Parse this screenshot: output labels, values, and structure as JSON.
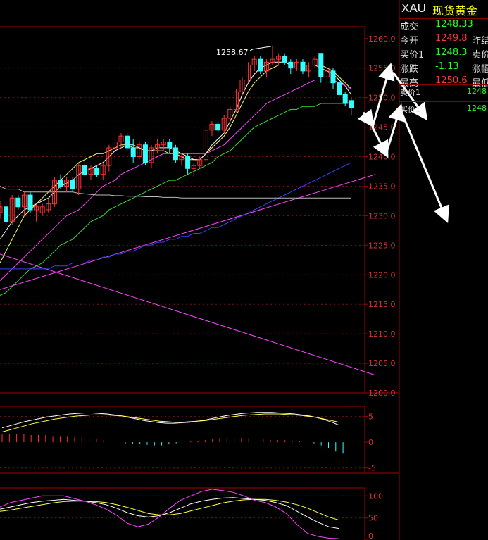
{
  "quote": {
    "symbol": "XAU",
    "name": "现货黄金",
    "rows": [
      {
        "label": "成交",
        "value": "1248.33",
        "color": "#22ff22",
        "label2": ""
      },
      {
        "label": "今开",
        "value": "1249.8",
        "color": "#ff3333",
        "label2": "昨结"
      },
      {
        "label": "买价1",
        "value": "1248.3",
        "color": "#22ff22",
        "label2": "卖价"
      },
      {
        "label": "涨跌",
        "value": "-1.13",
        "color": "#22ff22",
        "label2": "涨幅"
      },
      {
        "label": "最高",
        "value": "1250.6",
        "color": "#ff3333",
        "label2": "最低"
      }
    ],
    "orderbook": [
      {
        "label": "卖价1",
        "value": "1248"
      },
      {
        "label": "买价1",
        "value": "1248"
      }
    ]
  },
  "chart_data": [
    {
      "type": "candlestick",
      "ylim": [
        1200,
        1262
      ],
      "yticks": [
        "1260.0",
        "1255.0",
        "1250.0",
        "1245.0",
        "1240.0",
        "1235.0",
        "1230.0",
        "1225.0",
        "1220.0",
        "1215.0",
        "1210.0",
        "1205.0",
        "1200.0"
      ],
      "ytick_values": [
        1260,
        1255,
        1250,
        1245,
        1240,
        1235,
        1230,
        1225,
        1220,
        1215,
        1210,
        1205,
        1200
      ],
      "annotation": {
        "text": "1258.67",
        "value": 1258.67
      },
      "candles": [
        [
          1230.5,
          1232.5,
          1229.5,
          1231.5
        ],
        [
          1231.5,
          1232.0,
          1228.5,
          1229.0
        ],
        [
          1229.0,
          1233.5,
          1228.5,
          1233.0
        ],
        [
          1233.0,
          1233.5,
          1231.0,
          1231.5
        ],
        [
          1231.5,
          1234.0,
          1230.0,
          1233.5
        ],
        [
          1233.5,
          1234.0,
          1230.5,
          1231.0
        ],
        [
          1231.0,
          1232.0,
          1229.0,
          1231.5
        ],
        [
          1230.5,
          1232.0,
          1230.0,
          1231.5
        ],
        [
          1231.0,
          1233.0,
          1230.5,
          1232.0
        ],
        [
          1232.0,
          1236.5,
          1231.5,
          1236.0
        ],
        [
          1236.0,
          1237.0,
          1234.5,
          1235.0
        ],
        [
          1235.0,
          1236.5,
          1234.0,
          1236.0
        ],
        [
          1236.0,
          1236.5,
          1234.0,
          1234.5
        ],
        [
          1234.5,
          1239.0,
          1233.5,
          1238.5
        ],
        [
          1238.5,
          1240.0,
          1236.5,
          1237.0
        ],
        [
          1237.0,
          1238.5,
          1236.0,
          1238.0
        ],
        [
          1238.0,
          1238.5,
          1236.5,
          1237.0
        ],
        [
          1237.0,
          1239.0,
          1236.0,
          1238.5
        ],
        [
          1238.5,
          1242.0,
          1237.5,
          1241.5
        ],
        [
          1241.5,
          1243.0,
          1240.0,
          1242.5
        ],
        [
          1242.5,
          1244.0,
          1241.5,
          1243.5
        ],
        [
          1243.5,
          1244.0,
          1241.0,
          1241.5
        ],
        [
          1241.5,
          1243.0,
          1239.0,
          1240.0
        ],
        [
          1240.0,
          1242.5,
          1239.5,
          1242.0
        ],
        [
          1242.0,
          1242.5,
          1238.5,
          1239.0
        ],
        [
          1239.0,
          1242.0,
          1238.0,
          1241.5
        ],
        [
          1241.5,
          1243.0,
          1240.5,
          1242.0
        ],
        [
          1242.0,
          1243.0,
          1241.0,
          1242.5
        ],
        [
          1242.5,
          1243.0,
          1240.5,
          1241.5
        ],
        [
          1241.5,
          1242.0,
          1239.0,
          1239.5
        ],
        [
          1239.5,
          1240.5,
          1238.5,
          1240.0
        ],
        [
          1240.0,
          1240.5,
          1237.0,
          1238.0
        ],
        [
          1238.0,
          1239.0,
          1236.5,
          1238.5
        ],
        [
          1238.5,
          1240.0,
          1238.0,
          1239.5
        ],
        [
          1239.5,
          1245.0,
          1239.0,
          1244.5
        ],
        [
          1244.5,
          1246.0,
          1243.5,
          1245.5
        ],
        [
          1245.5,
          1246.0,
          1244.0,
          1244.5
        ],
        [
          1244.5,
          1247.0,
          1244.0,
          1246.5
        ],
        [
          1246.5,
          1248.5,
          1246.0,
          1248.0
        ],
        [
          1248.0,
          1251.5,
          1247.5,
          1251.0
        ],
        [
          1251.0,
          1253.5,
          1250.5,
          1253.0
        ],
        [
          1253.0,
          1256.0,
          1252.5,
          1255.5
        ],
        [
          1255.5,
          1257.0,
          1254.5,
          1256.5
        ],
        [
          1256.5,
          1257.0,
          1254.0,
          1254.5
        ],
        [
          1254.5,
          1256.5,
          1253.5,
          1256.0
        ],
        [
          1256.0,
          1258.67,
          1255.5,
          1256.5
        ],
        [
          1256.5,
          1257.5,
          1255.5,
          1257.0
        ],
        [
          1257.0,
          1257.5,
          1255.5,
          1256.0
        ],
        [
          1256.0,
          1256.5,
          1254.0,
          1255.0
        ],
        [
          1255.0,
          1256.5,
          1254.5,
          1256.0
        ],
        [
          1256.0,
          1256.5,
          1254.0,
          1254.5
        ],
        [
          1254.5,
          1256.0,
          1253.5,
          1255.5
        ],
        [
          1255.5,
          1257.0,
          1255.0,
          1256.5
        ],
        [
          1257.5,
          1257.5,
          1252.5,
          1253.5
        ],
        [
          1253.5,
          1255.0,
          1251.5,
          1254.5
        ],
        [
          1254.5,
          1255.0,
          1251.5,
          1252.5
        ],
        [
          1252.5,
          1253.5,
          1250.0,
          1250.5
        ],
        [
          1250.5,
          1251.0,
          1248.5,
          1249.0
        ],
        [
          1249.5,
          1250.0,
          1247.0,
          1248.3
        ]
      ],
      "ma_lines": [
        {
          "color": "#ffff66",
          "values": [
            1222,
            1224,
            1226,
            1228,
            1230,
            1231,
            1232,
            1233,
            1234,
            1235,
            1236,
            1237,
            1238,
            1239,
            1239.5,
            1240,
            1240.5,
            1240.5,
            1241,
            1241.5,
            1242,
            1242,
            1241.5,
            1241.5,
            1241,
            1241,
            1241,
            1241,
            1240.5,
            1240.5,
            1240,
            1239.5,
            1239.5,
            1239.5,
            1240.5,
            1241.5,
            1242.5,
            1243.5,
            1245,
            1247,
            1249,
            1251,
            1252.5,
            1253.5,
            1254.5,
            1255,
            1255.5,
            1255.5,
            1255.5,
            1255.5,
            1255.5,
            1255.5,
            1255.5,
            1255.5,
            1255,
            1254.5,
            1253.5,
            1252.5,
            1251.5
          ]
        },
        {
          "color": "#ffffff",
          "values": [
            1226,
            1227.5,
            1229,
            1230,
            1231,
            1231.5,
            1232,
            1232.5,
            1233,
            1234,
            1235,
            1235.5,
            1236,
            1237,
            1237.5,
            1238,
            1238.5,
            1239,
            1240,
            1241,
            1241.5,
            1242,
            1242,
            1241.5,
            1241,
            1241,
            1241.5,
            1241.5,
            1241.5,
            1241,
            1240.5,
            1240,
            1239.5,
            1239.5,
            1240.5,
            1242,
            1243,
            1244,
            1246,
            1248,
            1250.5,
            1252.5,
            1254,
            1255,
            1255.5,
            1256,
            1256,
            1256,
            1255.5,
            1255.5,
            1255.5,
            1255.5,
            1255.5,
            1255,
            1254.5,
            1254,
            1253,
            1252,
            1250.5
          ]
        },
        {
          "color": "#ff44ff",
          "values": [
            1219,
            1220,
            1221,
            1222,
            1223,
            1224,
            1225,
            1226,
            1227,
            1228,
            1229,
            1230,
            1230.5,
            1231,
            1232,
            1233,
            1234,
            1235,
            1235.5,
            1236,
            1237,
            1237.5,
            1238,
            1238.5,
            1239,
            1239.5,
            1240,
            1240.5,
            1240.5,
            1240.5,
            1240.5,
            1240.5,
            1240.5,
            1240.5,
            1240.5,
            1241,
            1241.5,
            1242,
            1243,
            1244,
            1245,
            1246,
            1247,
            1248,
            1249,
            1249.5,
            1250,
            1250.5,
            1251,
            1251.5,
            1252,
            1252.5,
            1253,
            1253,
            1253,
            1253,
            1252.5,
            1252,
            1251.5
          ]
        },
        {
          "color": "#33dd33",
          "values": [
            1216.5,
            1217,
            1218,
            1219,
            1220,
            1221,
            1221.5,
            1222,
            1223,
            1224,
            1225,
            1225.5,
            1226,
            1227,
            1228,
            1229,
            1229.5,
            1230,
            1231,
            1231.5,
            1232,
            1232.5,
            1233,
            1233.5,
            1234,
            1234.5,
            1235,
            1235.5,
            1236,
            1236,
            1236.5,
            1237,
            1237.5,
            1238,
            1238.5,
            1239,
            1240,
            1240.5,
            1241,
            1242,
            1243,
            1244,
            1245,
            1245.5,
            1246,
            1246.5,
            1247,
            1247.5,
            1248,
            1248,
            1248.5,
            1248.5,
            1248.5,
            1249,
            1249,
            1249,
            1249,
            1249,
            1249.2
          ]
        },
        {
          "color": "#3344ff",
          "values": [
            1221,
            1221,
            1221,
            1221,
            1221,
            1221,
            1221,
            1221,
            1221,
            1221.5,
            1221.5,
            1221.5,
            1222,
            1222,
            1222,
            1222.5,
            1222.5,
            1223,
            1223,
            1223.5,
            1223.5,
            1224,
            1224,
            1224.5,
            1225,
            1225,
            1225.5,
            1225.5,
            1226,
            1226,
            1226.5,
            1226.5,
            1227,
            1227,
            1227.5,
            1228,
            1228,
            1228.5,
            1229,
            1229.5,
            1230,
            1230.5,
            1231,
            1231.5,
            1232,
            1232.5,
            1233,
            1233.5,
            1234,
            1234.5,
            1235,
            1235.5,
            1236,
            1236.5,
            1237,
            1237.5,
            1238,
            1238.5,
            1239
          ]
        },
        {
          "color": "#bbbbbb",
          "values": [
            1235,
            1234.5,
            1234.5,
            1234.5,
            1234,
            1234,
            1234,
            1234,
            1234,
            1234,
            1234,
            1234,
            1234,
            1233.8,
            1233.7,
            1233.6,
            1233.5,
            1233.5,
            1233.5,
            1233.4,
            1233.4,
            1233.3,
            1233.3,
            1233.3,
            1233.2,
            1233.2,
            1233.2,
            1233.1,
            1233.1,
            1233.1,
            1233,
            1233,
            1233,
            1233,
            1233,
            1233,
            1233,
            1233,
            1233,
            1233,
            1233,
            1233,
            1233,
            1233,
            1233,
            1233,
            1233,
            1233,
            1233,
            1233,
            1233,
            1233,
            1233,
            1233,
            1233,
            1233,
            1233,
            1233,
            1233
          ]
        }
      ],
      "trend_lines": [
        {
          "color": "#ff44ff",
          "from": [
            0,
            1217.5
          ],
          "to": [
            62,
            1237
          ]
        },
        {
          "color": "#ff44ff",
          "from": [
            0,
            1223.5
          ],
          "to": [
            62,
            1203
          ]
        }
      ],
      "arrows": [
        {
          "from": [
            60,
            1247.5
          ],
          "to": [
            61.4,
            1245.5
          ]
        },
        {
          "from": [
            61.5,
            1245.0
          ],
          "to": [
            64.4,
            1255.2
          ]
        },
        {
          "from": [
            61.5,
            1245.0
          ],
          "to": [
            63.8,
            1240.4
          ]
        },
        {
          "from": [
            63.9,
            1241.0
          ],
          "to": [
            66.1,
            1248.3
          ]
        },
        {
          "from": [
            64.9,
            1254.3
          ],
          "to": [
            70.2,
            1246.7
          ]
        },
        {
          "from": [
            66.2,
            1247.8
          ],
          "to": [
            73.7,
            1229.4
          ]
        }
      ]
    },
    {
      "type": "macd",
      "ylim": [
        -6,
        7
      ],
      "yticks": [
        "5",
        "0",
        "-5"
      ],
      "ytick_values": [
        5,
        0,
        -5
      ],
      "dif": [
        2.8,
        3.2,
        3.6,
        4.0,
        4.3,
        4.6,
        4.9,
        5.1,
        5.3,
        5.5,
        5.6,
        5.7,
        5.7,
        5.6,
        5.5,
        5.3,
        5.1,
        4.8,
        4.5,
        4.2,
        4.0,
        3.8,
        3.7,
        3.7,
        3.8,
        3.9,
        4.1,
        4.3,
        4.6,
        4.9,
        5.2,
        5.4,
        5.6,
        5.7,
        5.8,
        5.8,
        5.8,
        5.7,
        5.6,
        5.5,
        5.3,
        5.1,
        4.8,
        4.4,
        3.9,
        3.3
      ],
      "dea": [
        2.0,
        2.4,
        2.8,
        3.2,
        3.6,
        3.9,
        4.2,
        4.5,
        4.7,
        4.9,
        5.1,
        5.2,
        5.3,
        5.3,
        5.3,
        5.2,
        5.1,
        4.9,
        4.7,
        4.5,
        4.3,
        4.1,
        4.0,
        3.9,
        3.9,
        4.0,
        4.1,
        4.2,
        4.4,
        4.6,
        4.8,
        5.0,
        5.2,
        5.3,
        5.4,
        5.5,
        5.5,
        5.5,
        5.4,
        5.3,
        5.2,
        5.0,
        4.8,
        4.5,
        4.2,
        3.9
      ],
      "hist": [
        1.6,
        1.6,
        1.6,
        1.6,
        1.4,
        1.4,
        1.4,
        1.2,
        1.2,
        1.2,
        1.0,
        1.0,
        0.8,
        0.6,
        0.4,
        0.2,
        0.0,
        -0.2,
        -0.3,
        -0.4,
        -0.5,
        -0.6,
        -0.6,
        -0.4,
        -0.2,
        0.0,
        0.2,
        0.3,
        0.4,
        0.6,
        0.8,
        0.8,
        0.8,
        0.8,
        0.8,
        0.6,
        0.6,
        0.4,
        0.4,
        0.4,
        0.2,
        0.2,
        0.0,
        -0.2,
        -0.6,
        -1.2,
        -1.8,
        -2.2
      ]
    },
    {
      "type": "kdj",
      "ylim": [
        0,
        118
      ],
      "yticks": [
        "100",
        "50",
        "0"
      ],
      "ytick_values": [
        100,
        50,
        0
      ],
      "k": [
        70,
        75,
        80,
        85,
        88,
        90,
        92,
        90,
        88,
        85,
        80,
        72,
        62,
        55,
        52,
        55,
        62,
        72,
        82,
        88,
        92,
        95,
        96,
        94,
        92,
        90,
        85,
        78,
        65,
        52,
        40,
        30,
        26
      ],
      "d": [
        65,
        68,
        72,
        76,
        80,
        84,
        87,
        88,
        88,
        87,
        85,
        80,
        74,
        67,
        60,
        57,
        57,
        60,
        66,
        72,
        78,
        84,
        88,
        91,
        92,
        92,
        90,
        86,
        80,
        72,
        62,
        52,
        45
      ],
      "j": [
        75,
        85,
        90,
        95,
        100,
        100,
        100,
        94,
        88,
        80,
        70,
        56,
        38,
        30,
        36,
        52,
        72,
        90,
        100,
        110,
        115,
        112,
        108,
        100,
        90,
        85,
        75,
        60,
        35,
        15,
        8,
        4,
        3
      ]
    }
  ]
}
